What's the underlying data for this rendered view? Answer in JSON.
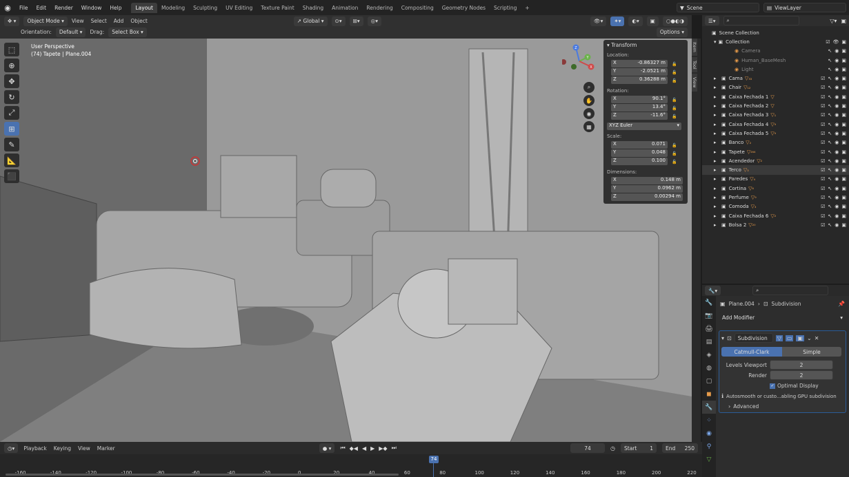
{
  "topbar": {
    "menus": [
      "File",
      "Edit",
      "Render",
      "Window",
      "Help"
    ],
    "workspaces": [
      "Layout",
      "Modeling",
      "Sculpting",
      "UV Editing",
      "Texture Paint",
      "Shading",
      "Animation",
      "Rendering",
      "Compositing",
      "Geometry Nodes",
      "Scripting"
    ],
    "active_workspace": "Layout",
    "add_tab": "+",
    "scene": "Scene",
    "view_layer": "ViewLayer"
  },
  "viewport_header": {
    "mode": "Object Mode",
    "menus": [
      "View",
      "Select",
      "Add",
      "Object"
    ],
    "transform_orientation": "Global",
    "orientation_label": "Orientation:",
    "orientation_value": "Default",
    "drag_label": "Drag:",
    "drag_value": "Select Box",
    "options": "Options"
  },
  "viewport": {
    "perspective": "User Perspective",
    "object_info": "(74) Tapete | Plane.004"
  },
  "gizmo": {
    "z": "Z",
    "y": "Y",
    "x": "X"
  },
  "npanel": {
    "title": "Transform",
    "location_label": "Location:",
    "location": [
      {
        "axis": "X",
        "value": "-0.86327 m"
      },
      {
        "axis": "Y",
        "value": "-2.0521 m"
      },
      {
        "axis": "Z",
        "value": "0.36288 m"
      }
    ],
    "rotation_label": "Rotation:",
    "rotation": [
      {
        "axis": "X",
        "value": "90.1°"
      },
      {
        "axis": "Y",
        "value": "13.4°"
      },
      {
        "axis": "Z",
        "value": "-11.6°"
      }
    ],
    "rotation_mode": "XYZ Euler",
    "scale_label": "Scale:",
    "scale": [
      {
        "axis": "X",
        "value": "0.071"
      },
      {
        "axis": "Y",
        "value": "0.048"
      },
      {
        "axis": "Z",
        "value": "0.100"
      }
    ],
    "dimensions_label": "Dimensions:",
    "dimensions": [
      {
        "axis": "X",
        "value": "0.148 m"
      },
      {
        "axis": "Y",
        "value": "0.0962 m"
      },
      {
        "axis": "Z",
        "value": "0.00294 m"
      }
    ]
  },
  "side_tabs": [
    "Item",
    "Tool",
    "View"
  ],
  "outliner": {
    "root": "Scene Collection",
    "collection": "Collection",
    "items": [
      {
        "name": "Camera",
        "dim": true,
        "child": true
      },
      {
        "name": "Human_BaseMesh",
        "dim": true,
        "child": true
      },
      {
        "name": "Light",
        "dim": true,
        "child": true
      },
      {
        "name": "Cama",
        "badge": "₃₃"
      },
      {
        "name": "Chair",
        "badge": "₁₂"
      },
      {
        "name": "Caixa Fechada 1",
        "badge": ""
      },
      {
        "name": "Caixa Fechada 2",
        "badge": ""
      },
      {
        "name": "Caixa Fechada 3",
        "badge": "₁"
      },
      {
        "name": "Caixa Fechada 4",
        "badge": "₉"
      },
      {
        "name": "Caixa Fechada 5",
        "badge": "₉"
      },
      {
        "name": "Banco",
        "badge": "₂"
      },
      {
        "name": "Tapete",
        "badge": "₂₆₄"
      },
      {
        "name": "Acendedor",
        "badge": "₂"
      },
      {
        "name": "Terco",
        "badge": "₃",
        "selected": true
      },
      {
        "name": "Paredes",
        "badge": "₄"
      },
      {
        "name": "Cortina",
        "badge": "₆"
      },
      {
        "name": "Perfume",
        "badge": "₉"
      },
      {
        "name": "Comoda",
        "badge": "₃"
      },
      {
        "name": "Caixa Fechada 6",
        "badge": "₂"
      },
      {
        "name": "Bolsa 2",
        "badge": "₂₀"
      }
    ]
  },
  "properties": {
    "object": "Plane.004",
    "modifier_crumb": "Subdivision",
    "add_modifier": "Add Modifier",
    "modifier_name": "Subdivision",
    "catmull": "Catmull-Clark",
    "simple": "Simple",
    "levels_viewport_label": "Levels Viewport",
    "levels_viewport": "2",
    "render_label": "Render",
    "render": "2",
    "optimal_display": "Optimal Display",
    "warning": "Autosmooth or custo...abling GPU subdivision",
    "advanced": "Advanced"
  },
  "timeline": {
    "menus": [
      "Playback",
      "Keying",
      "View",
      "Marker"
    ],
    "current_frame": "74",
    "start_label": "Start",
    "start": "1",
    "end_label": "End",
    "end": "250",
    "ticks": [
      "-160",
      "-140",
      "-120",
      "-100",
      "-80",
      "-60",
      "-40",
      "-20",
      "0",
      "20",
      "40",
      "60",
      "80",
      "100",
      "120",
      "140",
      "160",
      "180",
      "200",
      "220"
    ],
    "playhead": "74"
  }
}
